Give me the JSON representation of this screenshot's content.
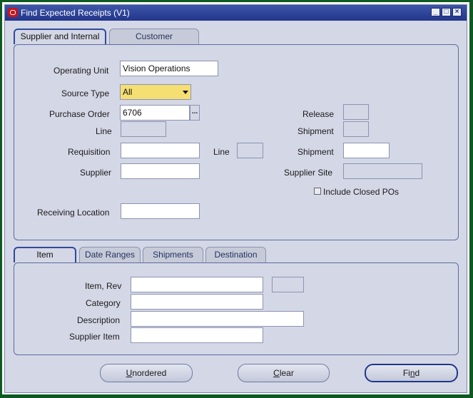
{
  "window": {
    "title": "Find Expected Receipts (V1)"
  },
  "top_tabs": [
    {
      "label": "Supplier and Internal"
    },
    {
      "label": "Customer"
    }
  ],
  "form": {
    "operating_unit": {
      "label": "Operating Unit",
      "value": "Vision Operations"
    },
    "source_type": {
      "label": "Source Type",
      "value": "All"
    },
    "purchase_order": {
      "label": "Purchase Order",
      "value": "6706",
      "lov": "..."
    },
    "po_line": {
      "label": "Line",
      "value": ""
    },
    "requisition": {
      "label": "Requisition",
      "value": ""
    },
    "req_line": {
      "label": "Line",
      "value": ""
    },
    "supplier": {
      "label": "Supplier",
      "value": ""
    },
    "receiving_location": {
      "label": "Receiving Location",
      "value": ""
    },
    "release": {
      "label": "Release",
      "value": ""
    },
    "po_shipment": {
      "label": "Shipment",
      "value": ""
    },
    "req_shipment": {
      "label": "Shipment",
      "value": ""
    },
    "supplier_site": {
      "label": "Supplier Site",
      "value": ""
    },
    "include_closed": {
      "label": "Include Closed POs",
      "checked": false
    }
  },
  "bottom_tabs": [
    {
      "label": "Item"
    },
    {
      "label": "Date Ranges"
    },
    {
      "label": "Shipments"
    },
    {
      "label": "Destination"
    }
  ],
  "item": {
    "item_rev": {
      "label": "Item, Rev",
      "value": "",
      "rev": ""
    },
    "category": {
      "label": "Category",
      "value": ""
    },
    "description": {
      "label": "Description",
      "value": ""
    },
    "supplier_item": {
      "label": "Supplier Item",
      "value": ""
    }
  },
  "buttons": {
    "unordered": {
      "label_first": "U",
      "label_rest": "nordered"
    },
    "clear": {
      "label_first": "C",
      "label_rest": "lear"
    },
    "find": {
      "label_first": "Fi",
      "label_ul": "n",
      "label_rest": "d"
    }
  }
}
